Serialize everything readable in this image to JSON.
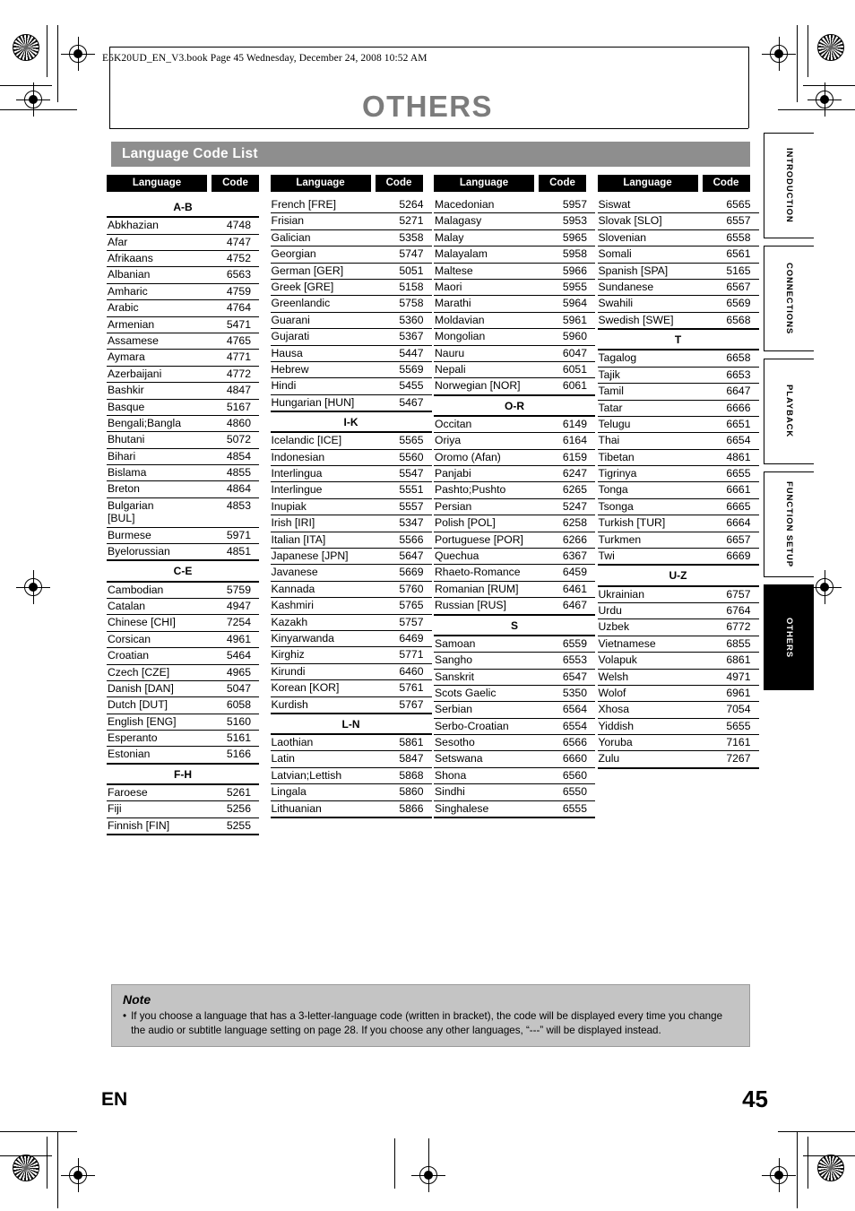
{
  "document": {
    "file_stamp": "E5K20UD_EN_V3.book  Page 45  Wednesday, December 24, 2008  10:52 AM",
    "chapter_title": "OTHERS",
    "section_title": "Language Code List",
    "footer_language": "EN",
    "footer_page": "45"
  },
  "table": {
    "header_language": "Language",
    "header_code": "Code"
  },
  "side_tabs": [
    {
      "label": "Introduction",
      "active": false
    },
    {
      "label": "Connections",
      "active": false
    },
    {
      "label": "Playback",
      "active": false
    },
    {
      "label": "Function Setup",
      "active": false
    },
    {
      "label": "Others",
      "active": true
    }
  ],
  "note": {
    "title": "Note",
    "bullet": "•",
    "text": "If you choose a language that has a 3-letter-language code (written in bracket), the code will be displayed every time you change the audio or subtitle language setting on page 28. If you choose any other languages, “---” will be displayed instead."
  },
  "columns": [
    {
      "rows": [
        {
          "type": "group",
          "label": "A-B"
        },
        {
          "type": "entry",
          "language": "Abkhazian",
          "code": "4748"
        },
        {
          "type": "entry",
          "language": "Afar",
          "code": "4747"
        },
        {
          "type": "entry",
          "language": "Afrikaans",
          "code": "4752"
        },
        {
          "type": "entry",
          "language": "Albanian",
          "code": "6563"
        },
        {
          "type": "entry",
          "language": "Amharic",
          "code": "4759"
        },
        {
          "type": "entry",
          "language": "Arabic",
          "code": "4764"
        },
        {
          "type": "entry",
          "language": "Armenian",
          "code": "5471"
        },
        {
          "type": "entry",
          "language": "Assamese",
          "code": "4765"
        },
        {
          "type": "entry",
          "language": "Aymara",
          "code": "4771"
        },
        {
          "type": "entry",
          "language": "Azerbaijani",
          "code": "4772"
        },
        {
          "type": "entry",
          "language": "Bashkir",
          "code": "4847"
        },
        {
          "type": "entry",
          "language": "Basque",
          "code": "5167"
        },
        {
          "type": "entry",
          "language": "Bengali;Bangla",
          "code": "4860"
        },
        {
          "type": "entry",
          "language": "Bhutani",
          "code": "5072"
        },
        {
          "type": "entry",
          "language": "Bihari",
          "code": "4854"
        },
        {
          "type": "entry",
          "language": "Bislama",
          "code": "4855"
        },
        {
          "type": "entry",
          "language": "Breton",
          "code": "4864"
        },
        {
          "type": "entry",
          "language": "Bulgarian [BUL]",
          "code": "4853"
        },
        {
          "type": "entry",
          "language": "Burmese",
          "code": "5971"
        },
        {
          "type": "entry",
          "language": "Byelorussian",
          "code": "4851",
          "last": true
        },
        {
          "type": "group",
          "label": "C-E"
        },
        {
          "type": "entry",
          "language": "Cambodian",
          "code": "5759"
        },
        {
          "type": "entry",
          "language": "Catalan",
          "code": "4947"
        },
        {
          "type": "entry",
          "language": "Chinese [CHI]",
          "code": "7254"
        },
        {
          "type": "entry",
          "language": "Corsican",
          "code": "4961"
        },
        {
          "type": "entry",
          "language": "Croatian",
          "code": "5464"
        },
        {
          "type": "entry",
          "language": "Czech [CZE]",
          "code": "4965"
        },
        {
          "type": "entry",
          "language": "Danish [DAN]",
          "code": "5047"
        },
        {
          "type": "entry",
          "language": "Dutch [DUT]",
          "code": "6058"
        },
        {
          "type": "entry",
          "language": "English [ENG]",
          "code": "5160"
        },
        {
          "type": "entry",
          "language": "Esperanto",
          "code": "5161"
        },
        {
          "type": "entry",
          "language": "Estonian",
          "code": "5166",
          "last": true
        },
        {
          "type": "group",
          "label": "F-H"
        },
        {
          "type": "entry",
          "language": "Faroese",
          "code": "5261"
        },
        {
          "type": "entry",
          "language": "Fiji",
          "code": "5256"
        },
        {
          "type": "entry",
          "language": "Finnish [FIN]",
          "code": "5255",
          "last": true
        }
      ]
    },
    {
      "rows": [
        {
          "type": "entry",
          "language": "French [FRE]",
          "code": "5264",
          "notop": true
        },
        {
          "type": "entry",
          "language": "Frisian",
          "code": "5271"
        },
        {
          "type": "entry",
          "language": "Galician",
          "code": "5358"
        },
        {
          "type": "entry",
          "language": "Georgian",
          "code": "5747"
        },
        {
          "type": "entry",
          "language": "German [GER]",
          "code": "5051"
        },
        {
          "type": "entry",
          "language": "Greek [GRE]",
          "code": "5158"
        },
        {
          "type": "entry",
          "language": "Greenlandic",
          "code": "5758"
        },
        {
          "type": "entry",
          "language": "Guarani",
          "code": "5360"
        },
        {
          "type": "entry",
          "language": "Gujarati",
          "code": "5367"
        },
        {
          "type": "entry",
          "language": "Hausa",
          "code": "5447"
        },
        {
          "type": "entry",
          "language": "Hebrew",
          "code": "5569"
        },
        {
          "type": "entry",
          "language": "Hindi",
          "code": "5455"
        },
        {
          "type": "entry",
          "language": "Hungarian [HUN]",
          "code": "5467",
          "last": true
        },
        {
          "type": "group",
          "label": "I-K"
        },
        {
          "type": "entry",
          "language": "Icelandic [ICE]",
          "code": "5565"
        },
        {
          "type": "entry",
          "language": "Indonesian",
          "code": "5560"
        },
        {
          "type": "entry",
          "language": "Interlingua",
          "code": "5547"
        },
        {
          "type": "entry",
          "language": "Interlingue",
          "code": "5551"
        },
        {
          "type": "entry",
          "language": "Inupiak",
          "code": "5557"
        },
        {
          "type": "entry",
          "language": "Irish [IRI]",
          "code": "5347"
        },
        {
          "type": "entry",
          "language": "Italian [ITA]",
          "code": "5566"
        },
        {
          "type": "entry",
          "language": "Japanese [JPN]",
          "code": "5647"
        },
        {
          "type": "entry",
          "language": "Javanese",
          "code": "5669"
        },
        {
          "type": "entry",
          "language": "Kannada",
          "code": "5760"
        },
        {
          "type": "entry",
          "language": "Kashmiri",
          "code": "5765"
        },
        {
          "type": "entry",
          "language": "Kazakh",
          "code": "5757"
        },
        {
          "type": "entry",
          "language": "Kinyarwanda",
          "code": "6469"
        },
        {
          "type": "entry",
          "language": "Kirghiz",
          "code": "5771"
        },
        {
          "type": "entry",
          "language": "Kirundi",
          "code": "6460"
        },
        {
          "type": "entry",
          "language": "Korean [KOR]",
          "code": "5761"
        },
        {
          "type": "entry",
          "language": "Kurdish",
          "code": "5767",
          "last": true
        },
        {
          "type": "group",
          "label": "L-N"
        },
        {
          "type": "entry",
          "language": "Laothian",
          "code": "5861"
        },
        {
          "type": "entry",
          "language": "Latin",
          "code": "5847"
        },
        {
          "type": "entry",
          "language": "Latvian;Lettish",
          "code": "5868"
        },
        {
          "type": "entry",
          "language": "Lingala",
          "code": "5860"
        },
        {
          "type": "entry",
          "language": "Lithuanian",
          "code": "5866",
          "last": true
        }
      ]
    },
    {
      "rows": [
        {
          "type": "entry",
          "language": "Macedonian",
          "code": "5957",
          "notop": true
        },
        {
          "type": "entry",
          "language": "Malagasy",
          "code": "5953"
        },
        {
          "type": "entry",
          "language": "Malay",
          "code": "5965"
        },
        {
          "type": "entry",
          "language": "Malayalam",
          "code": "5958"
        },
        {
          "type": "entry",
          "language": "Maltese",
          "code": "5966"
        },
        {
          "type": "entry",
          "language": "Maori",
          "code": "5955"
        },
        {
          "type": "entry",
          "language": "Marathi",
          "code": "5964"
        },
        {
          "type": "entry",
          "language": "Moldavian",
          "code": "5961"
        },
        {
          "type": "entry",
          "language": "Mongolian",
          "code": "5960"
        },
        {
          "type": "entry",
          "language": "Nauru",
          "code": "6047"
        },
        {
          "type": "entry",
          "language": "Nepali",
          "code": "6051"
        },
        {
          "type": "entry",
          "language": "Norwegian [NOR]",
          "code": "6061",
          "last": true
        },
        {
          "type": "group",
          "label": "O-R"
        },
        {
          "type": "entry",
          "language": "Occitan",
          "code": "6149"
        },
        {
          "type": "entry",
          "language": "Oriya",
          "code": "6164"
        },
        {
          "type": "entry",
          "language": "Oromo (Afan)",
          "code": "6159"
        },
        {
          "type": "entry",
          "language": "Panjabi",
          "code": "6247"
        },
        {
          "type": "entry",
          "language": "Pashto;Pushto",
          "code": "6265"
        },
        {
          "type": "entry",
          "language": "Persian",
          "code": "5247"
        },
        {
          "type": "entry",
          "language": "Polish [POL]",
          "code": "6258"
        },
        {
          "type": "entry",
          "language": "Portuguese [POR]",
          "code": "6266"
        },
        {
          "type": "entry",
          "language": "Quechua",
          "code": "6367"
        },
        {
          "type": "entry",
          "language": "Rhaeto-Romance",
          "code": "6459"
        },
        {
          "type": "entry",
          "language": "Romanian [RUM]",
          "code": "6461"
        },
        {
          "type": "entry",
          "language": "Russian [RUS]",
          "code": "6467",
          "last": true
        },
        {
          "type": "group",
          "label": "S"
        },
        {
          "type": "entry",
          "language": "Samoan",
          "code": "6559"
        },
        {
          "type": "entry",
          "language": "Sangho",
          "code": "6553"
        },
        {
          "type": "entry",
          "language": "Sanskrit",
          "code": "6547"
        },
        {
          "type": "entry",
          "language": "Scots Gaelic",
          "code": "5350"
        },
        {
          "type": "entry",
          "language": "Serbian",
          "code": "6564"
        },
        {
          "type": "entry",
          "language": "Serbo-Croatian",
          "code": "6554"
        },
        {
          "type": "entry",
          "language": "Sesotho",
          "code": "6566"
        },
        {
          "type": "entry",
          "language": "Setswana",
          "code": "6660"
        },
        {
          "type": "entry",
          "language": "Shona",
          "code": "6560"
        },
        {
          "type": "entry",
          "language": "Sindhi",
          "code": "6550"
        },
        {
          "type": "entry",
          "language": "Singhalese",
          "code": "6555",
          "last": true
        }
      ]
    },
    {
      "rows": [
        {
          "type": "entry",
          "language": "Siswat",
          "code": "6565",
          "notop": true
        },
        {
          "type": "entry",
          "language": "Slovak [SLO]",
          "code": "6557"
        },
        {
          "type": "entry",
          "language": "Slovenian",
          "code": "6558"
        },
        {
          "type": "entry",
          "language": "Somali",
          "code": "6561"
        },
        {
          "type": "entry",
          "language": "Spanish [SPA]",
          "code": "5165"
        },
        {
          "type": "entry",
          "language": "Sundanese",
          "code": "6567"
        },
        {
          "type": "entry",
          "language": "Swahili",
          "code": "6569"
        },
        {
          "type": "entry",
          "language": "Swedish [SWE]",
          "code": "6568",
          "last": true
        },
        {
          "type": "group",
          "label": "T"
        },
        {
          "type": "entry",
          "language": "Tagalog",
          "code": "6658"
        },
        {
          "type": "entry",
          "language": "Tajik",
          "code": "6653"
        },
        {
          "type": "entry",
          "language": "Tamil",
          "code": "6647"
        },
        {
          "type": "entry",
          "language": "Tatar",
          "code": "6666"
        },
        {
          "type": "entry",
          "language": "Telugu",
          "code": "6651"
        },
        {
          "type": "entry",
          "language": "Thai",
          "code": "6654"
        },
        {
          "type": "entry",
          "language": "Tibetan",
          "code": "4861"
        },
        {
          "type": "entry",
          "language": "Tigrinya",
          "code": "6655"
        },
        {
          "type": "entry",
          "language": "Tonga",
          "code": "6661"
        },
        {
          "type": "entry",
          "language": "Tsonga",
          "code": "6665"
        },
        {
          "type": "entry",
          "language": "Turkish [TUR]",
          "code": "6664"
        },
        {
          "type": "entry",
          "language": "Turkmen",
          "code": "6657"
        },
        {
          "type": "entry",
          "language": "Twi",
          "code": "6669",
          "last": true
        },
        {
          "type": "group",
          "label": "U-Z"
        },
        {
          "type": "entry",
          "language": "Ukrainian",
          "code": "6757"
        },
        {
          "type": "entry",
          "language": "Urdu",
          "code": "6764"
        },
        {
          "type": "entry",
          "language": "Uzbek",
          "code": "6772"
        },
        {
          "type": "entry",
          "language": "Vietnamese",
          "code": "6855"
        },
        {
          "type": "entry",
          "language": "Volapuk",
          "code": "6861"
        },
        {
          "type": "entry",
          "language": "Welsh",
          "code": "4971"
        },
        {
          "type": "entry",
          "language": "Wolof",
          "code": "6961"
        },
        {
          "type": "entry",
          "language": "Xhosa",
          "code": "7054"
        },
        {
          "type": "entry",
          "language": "Yiddish",
          "code": "5655"
        },
        {
          "type": "entry",
          "language": "Yoruba",
          "code": "7161"
        },
        {
          "type": "entry",
          "language": "Zulu",
          "code": "7267",
          "last": true
        }
      ]
    }
  ]
}
